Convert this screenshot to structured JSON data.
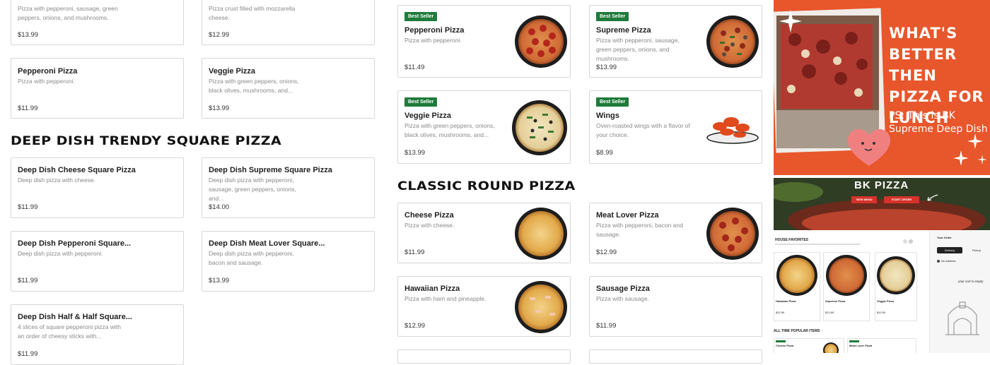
{
  "left_column": {
    "top_partial": [
      {
        "desc": "Pizza with pepperoni, sausage, green peppers, onions, and mushrooms.",
        "price": "$13.99"
      },
      {
        "desc": "Pizza crust filled with mozzarella cheese.",
        "price": "$12.99"
      }
    ],
    "row2": [
      {
        "title": "Pepperoni Pizza",
        "desc": "Pizza with pepperoni.",
        "price": "$11.99"
      },
      {
        "title": "Veggie Pizza",
        "desc": "Pizza with green peppers, onions, black olives, mushrooms, and...",
        "price": "$13.99"
      }
    ],
    "section_title": "DEEP DISH TRENDY SQUARE PIZZA",
    "deep_dish": [
      {
        "title": "Deep Dish Cheese Square Pizza",
        "desc": "Deep dish pizza with cheese.",
        "price": "$11.99"
      },
      {
        "title": "Deep Dish Supreme Square Pizza",
        "desc": "Deep dish pizza with pepperoni, sausage, green peppers, onions, and...",
        "price": "$14.00"
      },
      {
        "title": "Deep Dish Pepperoni Square...",
        "desc": "Deep dish pizza with pepperoni.",
        "price": "$11.99"
      },
      {
        "title": "Deep Dish Meat Lover Square...",
        "desc": "Deep dish pizza with pepperoni, bacon and sausage.",
        "price": "$13.99"
      },
      {
        "title": "Deep Dish Half & Half Square...",
        "desc": "4 slices of square pepperoni pizza with an order of cheesy sticks with...",
        "price": "$11.99"
      }
    ]
  },
  "middle_column": {
    "badge": "Best Seller",
    "best_sellers": [
      {
        "title": "Pepperoni Pizza",
        "desc": "Pizza with pepperoni.",
        "price": "$11.49"
      },
      {
        "title": "Supreme Pizza",
        "desc": "Pizza with pepperoni, sausage, green peppers, onions, and mushrooms.",
        "price": "$13.99"
      },
      {
        "title": "Veggie Pizza",
        "desc": "Pizza with green peppers, onions, black olives, mushrooms, and...",
        "price": "$13.99"
      },
      {
        "title": "Wings",
        "desc": "Oven-roasted wings with a flavor of your choice.",
        "price": "$8.99"
      }
    ],
    "section_title": "CLASSIC ROUND PIZZA",
    "classic": [
      {
        "title": "Cheese Pizza",
        "desc": "Pizza with cheese.",
        "price": "$11.99"
      },
      {
        "title": "Meat Lover Pizza",
        "desc": "Pizza with pepperoni, bacon and sausage.",
        "price": "$12.99"
      },
      {
        "title": "Hawaiian Pizza",
        "desc": "Pizza with ham and pineapple.",
        "price": "$12.99"
      },
      {
        "title": "Sausage Pizza",
        "desc": "Pizza with sausage.",
        "price": "$11.99"
      }
    ]
  },
  "promo1": {
    "headline": [
      "WHAT'S",
      "BETTER THEN",
      "PIZZA FOR",
      "LUNCH"
    ],
    "ps": [
      "PS: This is BK",
      "Supreme Deep Dish"
    ]
  },
  "promo2": {
    "brand": "BK PIZZA",
    "btn_menu": "VIEW MENU",
    "btn_order": "START ORDER",
    "favorites": "HOUSE FAVORITES",
    "popular": "ALL TIME POPULAR ITEMS",
    "your_order": "Your Order",
    "tab_delivery": "Delivery",
    "tab_pickup": "Pickup",
    "no_address": "No address",
    "cart_empty": "your cart is empty",
    "mini_items": [
      "Hawaiian Pizza",
      "Supreme Pizza",
      "Veggie Pizza"
    ],
    "mini_prices": [
      "$12.99",
      "$13.99",
      "$13.99"
    ],
    "mini_popular": [
      "Cheese Pizza",
      "Meat Lover Pizza"
    ]
  },
  "colors": {
    "badge_green": "#1e7b3a",
    "promo_orange": "#e8562b",
    "header_red": "#d6322b"
  }
}
